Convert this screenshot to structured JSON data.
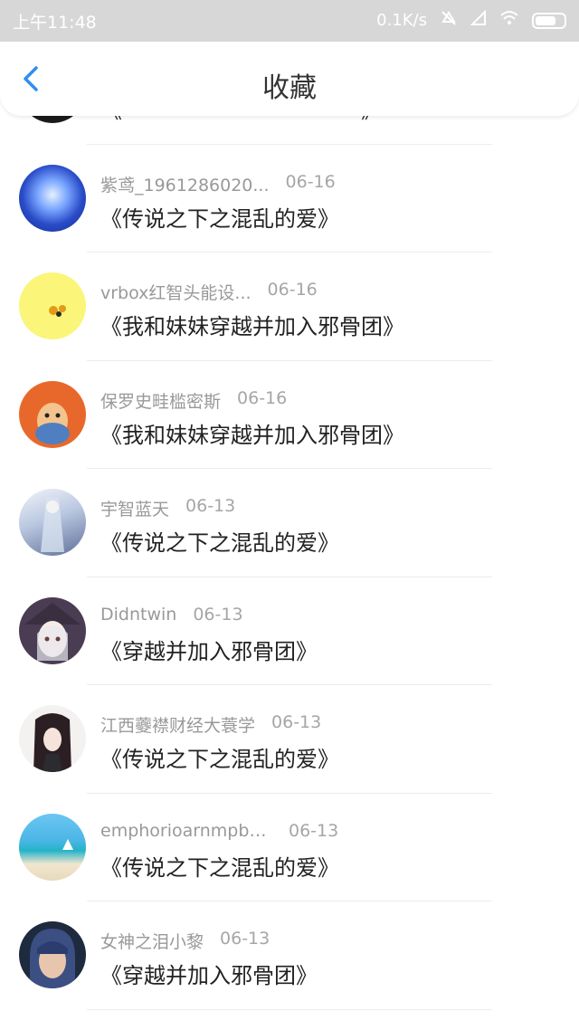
{
  "status_bar": {
    "time": "上午11:48",
    "speed": "0.1K/s"
  },
  "nav": {
    "title": "收藏"
  },
  "items": [
    {
      "username": "",
      "date": "",
      "book": "《　　　　　　　　　　　》"
    },
    {
      "username": "紫鸢_1961286020...",
      "date": "06-16",
      "book": "《传说之下之混乱的爱》"
    },
    {
      "username": "vrbox红智头能设...",
      "date": "06-16",
      "book": "《我和妹妹穿越并加入邪骨团》"
    },
    {
      "username": "保罗史畦槛密斯",
      "date": "06-16",
      "book": "《我和妹妹穿越并加入邪骨团》"
    },
    {
      "username": "宇智蓝天",
      "date": "06-13",
      "book": "《传说之下之混乱的爱》"
    },
    {
      "username": "Didntwin",
      "date": "06-13",
      "book": "《穿越并加入邪骨团》"
    },
    {
      "username": "江西虁襟财经大蓑学",
      "date": "06-13",
      "book": "《传说之下之混乱的爱》"
    },
    {
      "username": "emphorioarnmpby...",
      "date": "06-13",
      "book": "《传说之下之混乱的爱》"
    },
    {
      "username": "女神之泪小黎",
      "date": "06-13",
      "book": "《穿越并加入邪骨团》"
    }
  ],
  "colors": {
    "accent": "#2f8ff0",
    "status_bar": "#d7d7d7"
  }
}
